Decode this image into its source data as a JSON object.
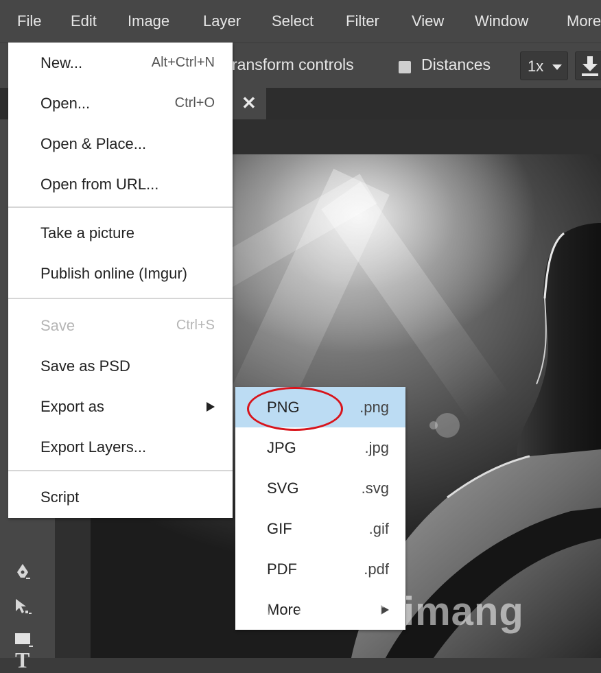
{
  "menubar": {
    "items": [
      "File",
      "Edit",
      "Image",
      "Layer",
      "Select",
      "Filter",
      "View",
      "Window",
      "More"
    ]
  },
  "options_bar": {
    "transform_label": "ransform controls",
    "distances_label": "Distances",
    "zoom_value": "1x"
  },
  "file_menu": {
    "items": [
      {
        "label": "New...",
        "shortcut": "Alt+Ctrl+N"
      },
      {
        "label": "Open...",
        "shortcut": "Ctrl+O"
      },
      {
        "label": "Open & Place..."
      },
      {
        "label": "Open from URL..."
      },
      {
        "label": "Take a picture"
      },
      {
        "label": "Publish online (Imgur)"
      },
      {
        "label": "Save",
        "shortcut": "Ctrl+S",
        "disabled": true
      },
      {
        "label": "Save as PSD"
      },
      {
        "label": "Export as",
        "submenu": true
      },
      {
        "label": "Export Layers..."
      },
      {
        "label": "Script"
      }
    ]
  },
  "export_menu": {
    "items": [
      {
        "label": "PNG",
        "ext": ".png",
        "active": true
      },
      {
        "label": "JPG",
        "ext": ".jpg"
      },
      {
        "label": "SVG",
        "ext": ".svg"
      },
      {
        "label": "GIF",
        "ext": ".gif"
      },
      {
        "label": "PDF",
        "ext": ".pdf"
      },
      {
        "label": "More",
        "submenu": true
      }
    ]
  },
  "toolbar": {
    "type_tool_glyph": "T"
  },
  "watermark": {
    "text": "uantrimang"
  },
  "colors": {
    "menubar_bg": "#474747",
    "menu_bg": "#ffffff",
    "highlight_bg": "#bcdcf3",
    "annotation_red": "#d8141b"
  }
}
